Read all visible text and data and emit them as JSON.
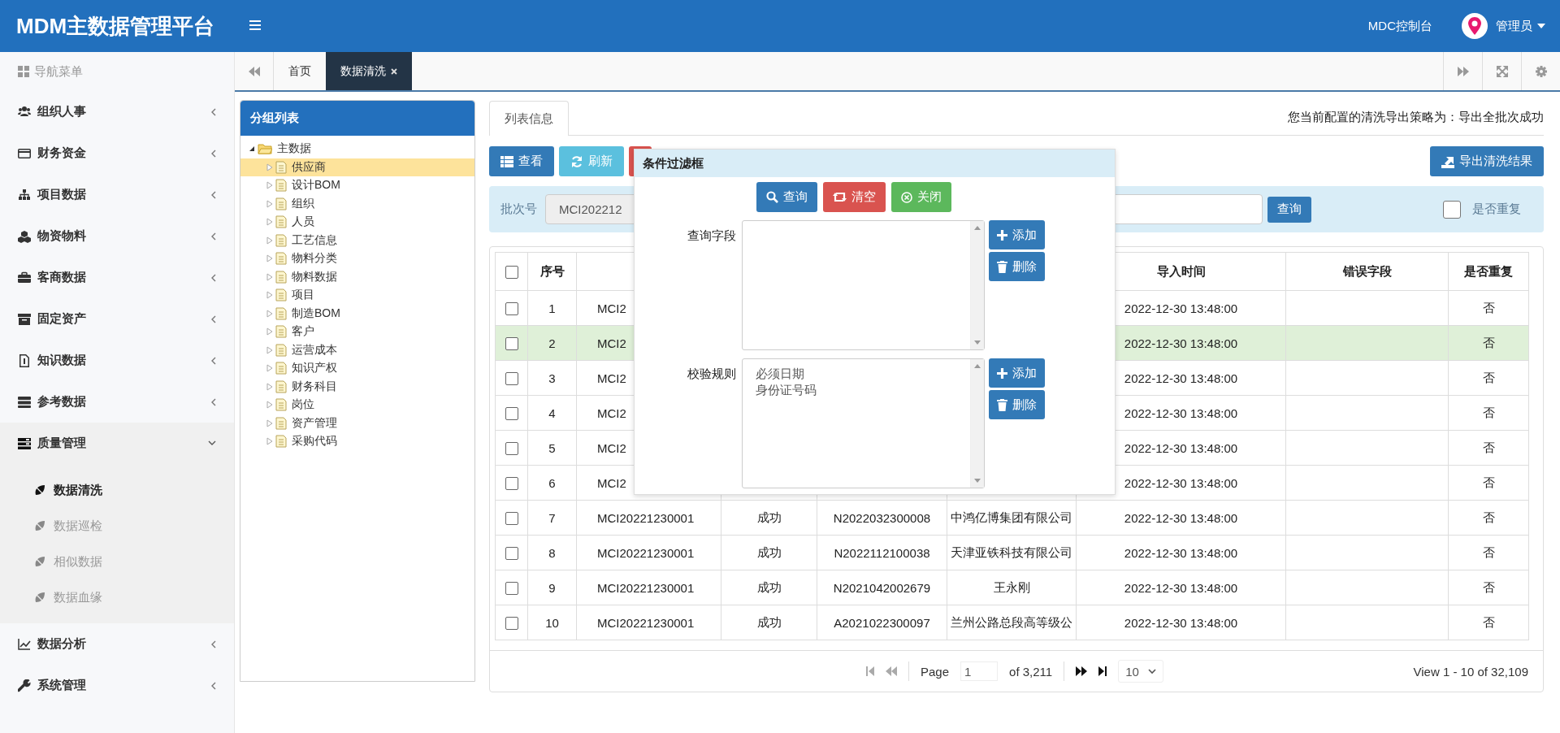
{
  "header": {
    "title": "MDM主数据管理平台",
    "console_link": "MDC控制台",
    "user": "管理员"
  },
  "sidebar": {
    "heading": "导航菜单",
    "items": [
      {
        "label": "组织人事",
        "expanded": false
      },
      {
        "label": "财务资金",
        "expanded": false
      },
      {
        "label": "项目数据",
        "expanded": false
      },
      {
        "label": "物资物料",
        "expanded": false
      },
      {
        "label": "客商数据",
        "expanded": false
      },
      {
        "label": "固定资产",
        "expanded": false
      },
      {
        "label": "知识数据",
        "expanded": false
      },
      {
        "label": "参考数据",
        "expanded": false
      },
      {
        "label": "质量管理",
        "expanded": true,
        "children": [
          {
            "label": "数据清洗",
            "selected": true
          },
          {
            "label": "数据巡检",
            "selected": false
          },
          {
            "label": "相似数据",
            "selected": false
          },
          {
            "label": "数据血缘",
            "selected": false
          }
        ]
      },
      {
        "label": "数据分析",
        "expanded": false
      },
      {
        "label": "系统管理",
        "expanded": false
      }
    ]
  },
  "tabs": [
    {
      "label": "首页",
      "selected": false,
      "closable": false
    },
    {
      "label": "数据清洗",
      "selected": true,
      "closable": true
    }
  ],
  "group_panel": {
    "title": "分组列表",
    "tree": [
      {
        "label": "主数据",
        "expanded": true,
        "children": [
          {
            "label": "供应商",
            "selected": true
          },
          {
            "label": "设计BOM",
            "selected": false
          },
          {
            "label": "组织",
            "selected": false
          },
          {
            "label": "人员",
            "selected": false
          },
          {
            "label": "工艺信息",
            "selected": false
          },
          {
            "label": "物料分类",
            "selected": false
          },
          {
            "label": "物料数据",
            "selected": false
          },
          {
            "label": "项目",
            "selected": false
          },
          {
            "label": "制造BOM",
            "selected": false
          },
          {
            "label": "客户",
            "selected": false
          },
          {
            "label": "运营成本",
            "selected": false
          },
          {
            "label": "知识产权",
            "selected": false
          },
          {
            "label": "财务科目",
            "selected": false
          },
          {
            "label": "岗位",
            "selected": false
          },
          {
            "label": "资产管理",
            "selected": false
          },
          {
            "label": "采购代码",
            "selected": false
          }
        ]
      }
    ]
  },
  "content_tabs": [
    {
      "label": "列表信息",
      "selected": true
    }
  ],
  "strategy_note": "您当前配置的清洗导出策略为：导出全批次成功",
  "toolbar": {
    "buttons": [
      {
        "label": "查看",
        "kind": "view"
      },
      {
        "label": "刷新",
        "kind": "refresh"
      },
      {
        "kind": "danger"
      }
    ],
    "export_button": "导出清洗结果"
  },
  "filter": {
    "batch_label": "批次号",
    "batch_value": "MCI202212",
    "search_button": "查询",
    "duplicate_label": "是否重复",
    "duplicate_checked": false
  },
  "table": {
    "all_checked": false,
    "columns": [
      "序号",
      null,
      null,
      null,
      null,
      "导入时间",
      "错误字段",
      "是否重复"
    ],
    "rows": [
      {
        "selected": false,
        "checked": false,
        "cells": [
          "1",
          "MCI2",
          null,
          null,
          null,
          "2022-12-30 13:48:00",
          null,
          "否"
        ]
      },
      {
        "selected": true,
        "checked": false,
        "cells": [
          "2",
          "MCI2",
          null,
          null,
          null,
          "2022-12-30 13:48:00",
          null,
          "否"
        ]
      },
      {
        "selected": false,
        "checked": false,
        "cells": [
          "3",
          "MCI2",
          null,
          null,
          null,
          "2022-12-30 13:48:00",
          null,
          "否"
        ]
      },
      {
        "selected": false,
        "checked": false,
        "cells": [
          "4",
          "MCI2",
          null,
          null,
          null,
          "2022-12-30 13:48:00",
          null,
          "否"
        ]
      },
      {
        "selected": false,
        "checked": false,
        "cells": [
          "5",
          "MCI2",
          null,
          null,
          null,
          "2022-12-30 13:48:00",
          null,
          "否"
        ]
      },
      {
        "selected": false,
        "checked": false,
        "cells": [
          "6",
          "MCI2",
          null,
          null,
          null,
          "2022-12-30 13:48:00",
          null,
          "否"
        ]
      },
      {
        "selected": false,
        "checked": false,
        "cells": [
          "7",
          "MCI20221230001",
          "成功",
          "N2022032300008",
          "中鸿亿博集团有限公司",
          "2022-12-30 13:48:00",
          null,
          "否"
        ]
      },
      {
        "selected": false,
        "checked": false,
        "cells": [
          "8",
          "MCI20221230001",
          "成功",
          "N2022112100038",
          "天津亚铁科技有限公司",
          "2022-12-30 13:48:00",
          null,
          "否"
        ]
      },
      {
        "selected": false,
        "checked": false,
        "cells": [
          "9",
          "MCI20221230001",
          "成功",
          "N2021042002679",
          "王永刚",
          "2022-12-30 13:48:00",
          null,
          "否"
        ]
      },
      {
        "selected": false,
        "checked": false,
        "cells": [
          "10",
          "MCI20221230001",
          "成功",
          "A2021022300097",
          "兰州公路总段高等级公",
          "2022-12-30 13:48:00",
          null,
          "否"
        ]
      }
    ]
  },
  "pager": {
    "page_label": "Page",
    "page": "1",
    "of_pages": "of 3,211",
    "page_size": "10",
    "summary": "View 1 - 10 of 32,109"
  },
  "dialog": {
    "title": "条件过滤框",
    "buttons": [
      {
        "label": "查询",
        "kind": "search"
      },
      {
        "label": "清空",
        "kind": "clear"
      },
      {
        "label": "关闭",
        "kind": "close"
      }
    ],
    "sections": [
      {
        "label": "查询字段",
        "add_button": "添加",
        "delete_button": "删除"
      },
      {
        "label": "校验规则",
        "options": [
          "必须日期",
          "身份证号码"
        ],
        "add_button": "添加",
        "delete_button": "删除"
      }
    ]
  }
}
